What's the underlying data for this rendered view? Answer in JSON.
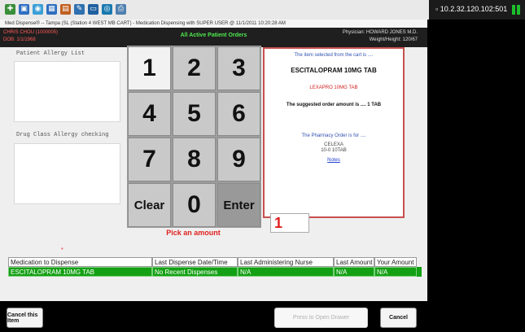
{
  "taskbar": {
    "icons": [
      "app-icon",
      "window-icon",
      "earth-icon",
      "chart-icon",
      "grid-icon",
      "tools-icon",
      "monitor-icon",
      "globe-icon",
      "printer-icon"
    ],
    "ip_text": "▫ 10.2.32.120.102:501",
    "signal_color": "#1cbf2c"
  },
  "window": {
    "title": "Med Dispense® -- Tampa (SL (Station 4 WEST MB CART) - Medication Dispensing with SUPER USER @ 11/1/2011 10:20:28 AM"
  },
  "header": {
    "patient_name": "CHRIS CHOU (1000005)",
    "patient_dob": "DOB: 1/1/1968",
    "center_title": "All Active Patient Orders",
    "physician": "Physician: HOWARD JONES M.D.",
    "weight_height": "Weight/Height: 120/67"
  },
  "allergy": {
    "patient_label": "Patient Allergy List",
    "drug_class_label": "Drug Class Allergy checking"
  },
  "keypad": {
    "k1": "1",
    "k2": "2",
    "k3": "3",
    "k4": "4",
    "k5": "5",
    "k6": "6",
    "k7": "7",
    "k8": "8",
    "k9": "9",
    "clear": "Clear",
    "k0": "0",
    "enter": "Enter"
  },
  "info_panel": {
    "selected_label": "The item selected from the cart is ....",
    "selected_item": "ESCITALOPRAM 10MG TAB",
    "brand_item": "LEXAPRO 10MG TAB",
    "suggested_amount": "The suggested order amount is .... 1 TAB",
    "pharmacy_label": "The Pharmacy Order is for ....",
    "pharmacy_drug": "CELEXA",
    "pharmacy_dose": "10-0 10TAB",
    "notes_link": "Notes"
  },
  "amount": {
    "pick_label": "Pick an amount",
    "value": "1",
    "marker": "*"
  },
  "table": {
    "columns": [
      "Medication to Dispense",
      "Last Dispense Date/Time",
      "Last Administering Nurse",
      "Last Amount",
      "Your Amount"
    ],
    "rows": [
      [
        "ESCITALOPRAM 10MG TAB",
        "No Recent Dispenses",
        "N/A",
        "N/A",
        "N/A"
      ]
    ]
  },
  "footer": {
    "cancel_item": "Cancel this Item",
    "open_drawer": "Press to Open Drawer",
    "cancel": "Cancel"
  }
}
